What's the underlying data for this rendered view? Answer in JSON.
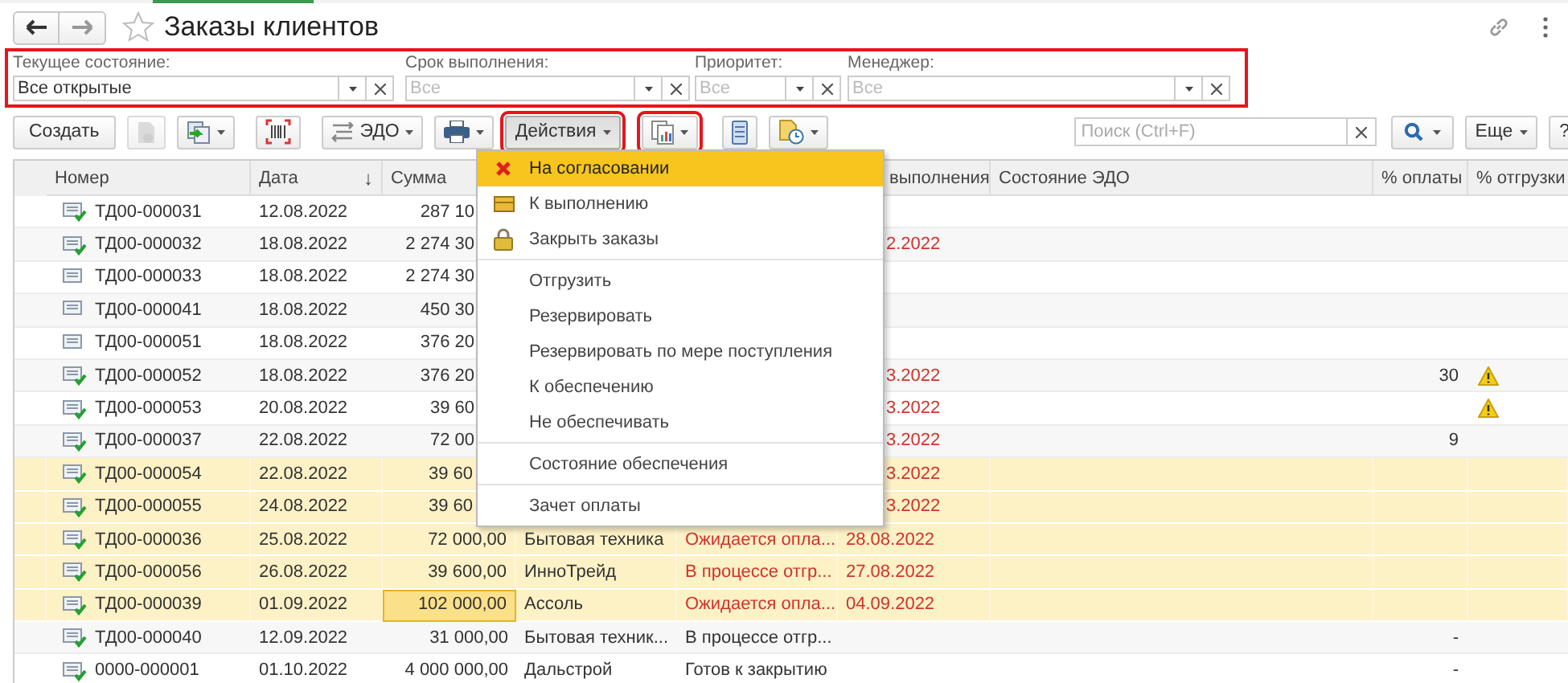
{
  "window": {
    "title": "Заказы клиентов",
    "favorite": false
  },
  "filters": {
    "annotated": true,
    "fields": [
      {
        "label": "Текущее состояние:",
        "value": "Все открытые"
      },
      {
        "label": "Срок выполнения:",
        "placeholder": "Все"
      },
      {
        "label": "Приоритет:",
        "placeholder": "Все"
      },
      {
        "label": "Менеджер:",
        "placeholder": "Все"
      }
    ]
  },
  "toolbar": {
    "items": [
      {
        "kind": "text",
        "label": "Создать",
        "dropdown": false,
        "disabled": false,
        "pressed": false,
        "annotated": false
      },
      {
        "kind": "icon",
        "dropdown": false,
        "disabled": true,
        "pressed": false,
        "annotated": false
      },
      {
        "kind": "icon",
        "dropdown": true,
        "disabled": false,
        "pressed": false,
        "annotated": false
      },
      {
        "kind": "icon",
        "dropdown": false,
        "disabled": false,
        "pressed": false,
        "annotated": false
      },
      {
        "kind": "text",
        "label": "ЭДО",
        "dropdown": true,
        "disabled": false,
        "pressed": false,
        "annotated": false
      },
      {
        "kind": "icon",
        "dropdown": true,
        "disabled": false,
        "pressed": false,
        "annotated": false
      },
      {
        "kind": "text",
        "label": "Действия",
        "dropdown": true,
        "disabled": false,
        "pressed": true,
        "annotated": true
      },
      {
        "kind": "icon",
        "dropdown": true,
        "disabled": false,
        "pressed": false,
        "annotated": true
      },
      {
        "kind": "icon",
        "dropdown": false,
        "disabled": false,
        "pressed": false,
        "annotated": false
      },
      {
        "kind": "icon",
        "dropdown": true,
        "disabled": false,
        "pressed": false,
        "annotated": false
      }
    ],
    "search": {
      "placeholder": "Поиск (Ctrl+F)"
    },
    "more": "Еще",
    "help": "?"
  },
  "table": {
    "columns": [
      {
        "label": "Номер"
      },
      {
        "label": "Дата",
        "sort": "↓"
      },
      {
        "label": "Сумма"
      },
      {
        "label": "выполнения"
      },
      {
        "label": "Состояние ЭДО"
      },
      {
        "label": "% оплаты"
      },
      {
        "label": "% отгрузки"
      }
    ],
    "rows": [
      {
        "number": "ТД00-000031",
        "date": "12.08.2022",
        "sum": "287 10",
        "posted": true,
        "highlighted": false,
        "current": false,
        "warning": false
      },
      {
        "number": "ТД00-000032",
        "date": "18.08.2022",
        "sum": "2 274 30",
        "due": "2.2022",
        "posted": true,
        "highlighted": false,
        "overdue": true,
        "current": false,
        "warning": false
      },
      {
        "number": "ТД00-000033",
        "date": "18.08.2022",
        "sum": "2 274 30",
        "posted": false,
        "highlighted": false,
        "current": false,
        "warning": false
      },
      {
        "number": "ТД00-000041",
        "date": "18.08.2022",
        "sum": "450 30",
        "posted": false,
        "highlighted": false,
        "current": false,
        "warning": false
      },
      {
        "number": "ТД00-000051",
        "date": "18.08.2022",
        "sum": "376 20",
        "posted": false,
        "highlighted": false,
        "current": false,
        "warning": false
      },
      {
        "number": "ТД00-000052",
        "date": "18.08.2022",
        "sum": "376 20",
        "due": "3.2022",
        "pay": "30",
        "posted": true,
        "highlighted": false,
        "overdue": true,
        "current": false,
        "warning": true
      },
      {
        "number": "ТД00-000053",
        "date": "20.08.2022",
        "sum": "39 60",
        "due": "3.2022",
        "posted": true,
        "highlighted": false,
        "overdue": true,
        "current": false,
        "warning": true
      },
      {
        "number": "ТД00-000037",
        "date": "22.08.2022",
        "sum": "72 00",
        "due": "3.2022",
        "pay": "9",
        "posted": true,
        "highlighted": false,
        "overdue": true,
        "current": false,
        "warning": false
      },
      {
        "number": "ТД00-000054",
        "date": "22.08.2022",
        "sum": "39 60",
        "due": "3.2022",
        "posted": true,
        "highlighted": true,
        "overdue": true,
        "current": false,
        "warning": false
      },
      {
        "number": "ТД00-000055",
        "date": "24.08.2022",
        "sum": "39 60",
        "due": "3.2022",
        "posted": true,
        "highlighted": true,
        "overdue": true,
        "current": false,
        "warning": false
      },
      {
        "number": "ТД00-000036",
        "date": "25.08.2022",
        "sum": "72 000,00",
        "counterparty": "Бытовая техника",
        "status": "Ожидается опла...",
        "due": "28.08.2022",
        "posted": true,
        "highlighted": true,
        "overdue": true,
        "current": false,
        "warning": false
      },
      {
        "number": "ТД00-000056",
        "date": "26.08.2022",
        "sum": "39 600,00",
        "counterparty": "ИнноТрейд",
        "status": "В процессе отгр...",
        "due": "27.08.2022",
        "posted": true,
        "highlighted": true,
        "overdue": true,
        "current": false,
        "warning": false
      },
      {
        "number": "ТД00-000039",
        "date": "01.09.2022",
        "sum": "102 000,00",
        "counterparty": "Ассоль",
        "status": "Ожидается опла...",
        "due": "04.09.2022",
        "posted": true,
        "highlighted": true,
        "overdue": true,
        "current": true,
        "warning": false
      },
      {
        "number": "ТД00-000040",
        "date": "12.09.2022",
        "sum": "31 000,00",
        "counterparty": "Бытовая техник...",
        "status": "В процессе отгр...",
        "pay": "-",
        "posted": true,
        "highlighted": false,
        "overdue": false,
        "current": false,
        "warning": false
      },
      {
        "number": "0000-000001",
        "date": "01.10.2022",
        "sum": "4 000 000,00",
        "counterparty": "Дальстрой",
        "status": "Готов к закрытию",
        "pay": "-",
        "posted": true,
        "highlighted": false,
        "overdue": false,
        "current": false,
        "warning": false
      }
    ]
  },
  "menu": {
    "groups": [
      [
        {
          "label": "На согласовании",
          "selected": true
        },
        {
          "label": "К выполнению",
          "selected": false
        },
        {
          "label": "Закрыть заказы",
          "selected": false
        }
      ],
      [
        {
          "label": "Отгрузить",
          "selected": false
        },
        {
          "label": "Резервировать",
          "selected": false
        },
        {
          "label": "Резервировать по мере поступления",
          "selected": false
        },
        {
          "label": "К обеспечению",
          "selected": false
        },
        {
          "label": "Не обеспечивать",
          "selected": false
        }
      ],
      [
        {
          "label": "Состояние обеспечения",
          "selected": false
        }
      ],
      [
        {
          "label": "Зачет оплаты",
          "selected": false
        }
      ]
    ]
  }
}
